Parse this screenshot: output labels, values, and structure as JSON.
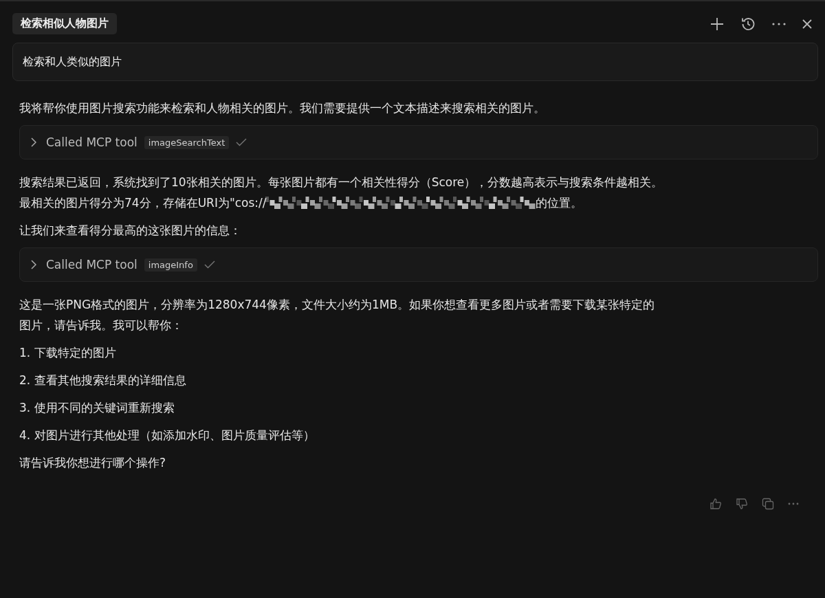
{
  "tab": {
    "label": "检索相似人物图片"
  },
  "prompt": "检索和人类似的图片",
  "messages": [
    {
      "kind": "text",
      "lines": [
        "我将帮你使用图片搜索功能来检索和人物相关的图片。我们需要提供一个文本描述来搜索相关的图片。"
      ]
    },
    {
      "kind": "tool",
      "label": "Called MCP tool",
      "tool": "imageSearchText",
      "done": true
    },
    {
      "kind": "text",
      "lines": [
        "搜索结果已返回，系统找到了10张相关的图片。每张图片都有一个相关性得分（Score），分数越高表示与搜索条件越相关。"
      ]
    },
    {
      "kind": "redacted",
      "before": "最相关的图片得分为74分，存储在URI为\"cos://",
      "after": "的位置。"
    },
    {
      "kind": "text",
      "lines": [
        "让我们来查看得分最高的这张图片的信息："
      ]
    },
    {
      "kind": "tool",
      "label": "Called MCP tool",
      "tool": "imageInfo",
      "done": true
    },
    {
      "kind": "text",
      "lines": [
        "这是一张PNG格式的图片，分辨率为1280x744像素，文件大小约为1MB。如果你想查看更多图片或者需要下载某张特定的",
        "图片，请告诉我。我可以帮你："
      ]
    },
    {
      "kind": "item",
      "text": "1. 下载特定的图片"
    },
    {
      "kind": "item",
      "text": "2. 查看其他搜索结果的详细信息"
    },
    {
      "kind": "item",
      "text": "3. 使用不同的关键词重新搜索"
    },
    {
      "kind": "item",
      "text": "4. 对图片进行其他处理（如添加水印、图片质量评估等）"
    },
    {
      "kind": "text",
      "lines": [
        "请告诉我你想进行哪个操作?"
      ]
    }
  ]
}
